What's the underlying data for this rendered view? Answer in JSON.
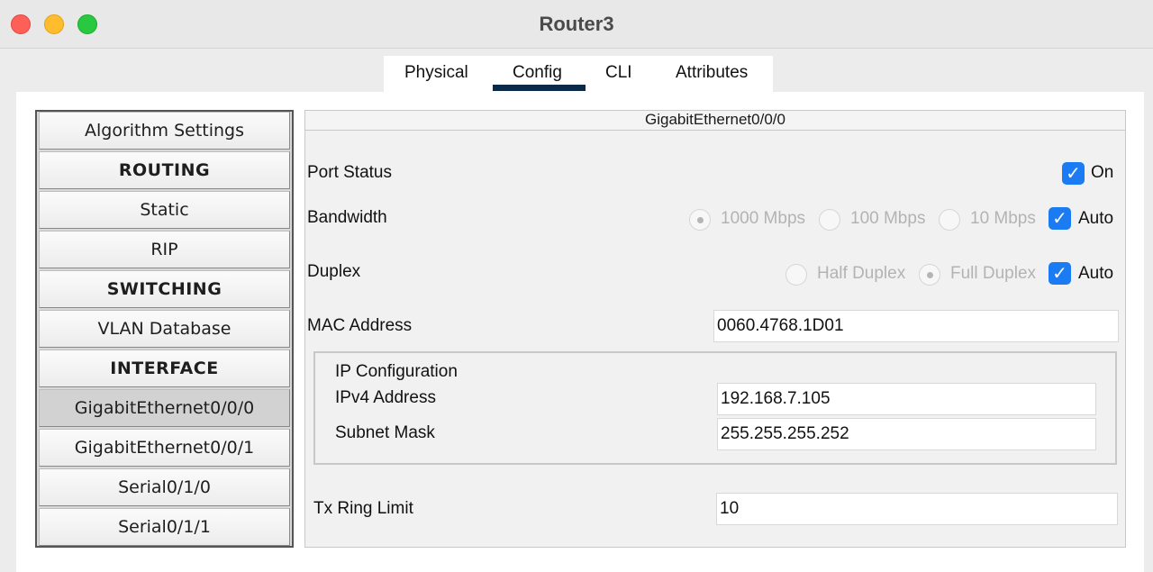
{
  "window": {
    "title": "Router3"
  },
  "tabs": [
    {
      "label": "Physical"
    },
    {
      "label": "Config"
    },
    {
      "label": "CLI"
    },
    {
      "label": "Attributes"
    }
  ],
  "active_tab": "Config",
  "sidebar": {
    "items": [
      {
        "label": "Algorithm Settings"
      },
      {
        "label": "ROUTING"
      },
      {
        "label": "Static"
      },
      {
        "label": "RIP"
      },
      {
        "label": "SWITCHING"
      },
      {
        "label": "VLAN Database"
      },
      {
        "label": "INTERFACE"
      },
      {
        "label": "GigabitEthernet0/0/0"
      },
      {
        "label": "GigabitEthernet0/0/1"
      },
      {
        "label": "Serial0/1/0"
      },
      {
        "label": "Serial0/1/1"
      }
    ],
    "selected": "GigabitEthernet0/0/0"
  },
  "panel": {
    "title": "GigabitEthernet0/0/0",
    "port_status": {
      "label": "Port Status",
      "on_label": "On",
      "checked": true
    },
    "bandwidth": {
      "label": "Bandwidth",
      "options": [
        "1000 Mbps",
        "100 Mbps",
        "10 Mbps"
      ],
      "selected": "1000 Mbps",
      "auto_label": "Auto",
      "auto_checked": true
    },
    "duplex": {
      "label": "Duplex",
      "options": [
        "Half Duplex",
        "Full Duplex"
      ],
      "selected": "Full Duplex",
      "auto_label": "Auto",
      "auto_checked": true
    },
    "mac": {
      "label": "MAC Address",
      "value": "0060.4768.1D01"
    },
    "ip_config": {
      "title": "IP Configuration",
      "ipv4_label": "IPv4 Address",
      "ipv4_value": "192.168.7.105",
      "mask_label": "Subnet Mask",
      "mask_value": "255.255.255.252"
    },
    "tx_ring": {
      "label": "Tx Ring Limit",
      "value": "10"
    }
  },
  "colors": {
    "checkbox": "#1a7bf2",
    "tab_underline": "#0b2a4a"
  }
}
